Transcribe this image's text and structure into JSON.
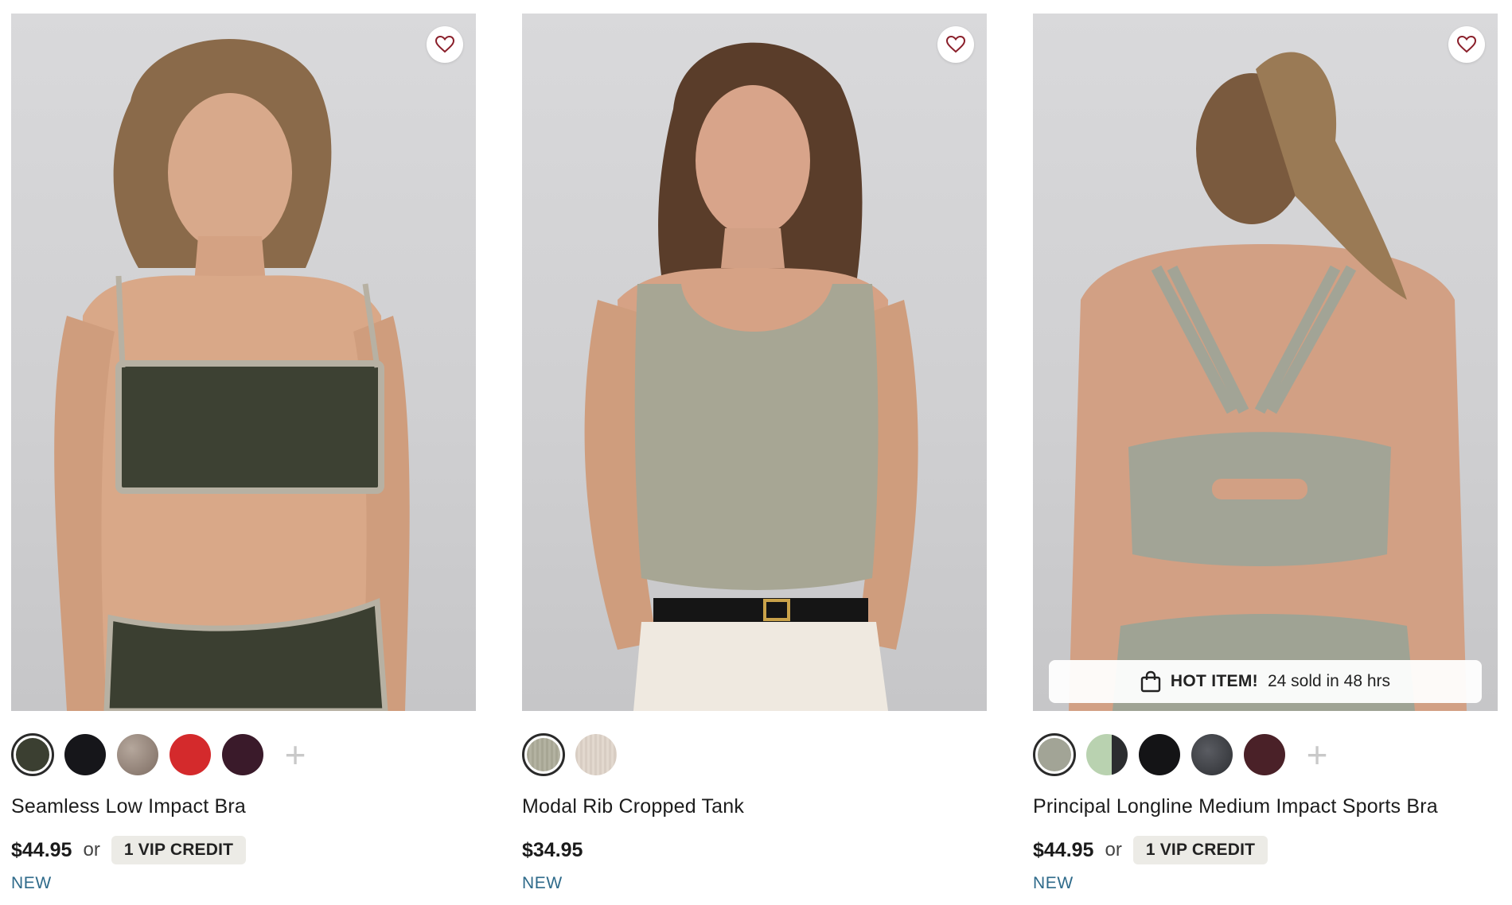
{
  "products": [
    {
      "name": "Seamless Low Impact Bra",
      "price": "$44.95",
      "or_text": "or",
      "credit": "1 VIP CREDIT",
      "badge": "NEW",
      "swatches": [
        "#3b3f31",
        "#16161a",
        "#8a7a70",
        "#d42a2c",
        "#3a1a2a"
      ],
      "more_icon": "+"
    },
    {
      "name": "Modal Rib Cropped Tank",
      "price": "$34.95",
      "badge": "NEW",
      "swatches": [
        "#a7a694",
        "#d8cdc3"
      ]
    },
    {
      "name": "Principal Longline Medium Impact Sports Bra",
      "price": "$44.95",
      "or_text": "or",
      "credit": "1 VIP CREDIT",
      "badge": "NEW",
      "hot_label": "HOT ITEM!",
      "hot_text": "24 sold in 48 hrs",
      "swatches": [
        "#a2a496",
        "#b9d2b0",
        "#141416",
        "#3a3c40",
        "#4a2128"
      ],
      "more_icon": "+"
    }
  ],
  "icons": {
    "favorite": "heart-icon",
    "bag": "shopping-bag-icon"
  }
}
